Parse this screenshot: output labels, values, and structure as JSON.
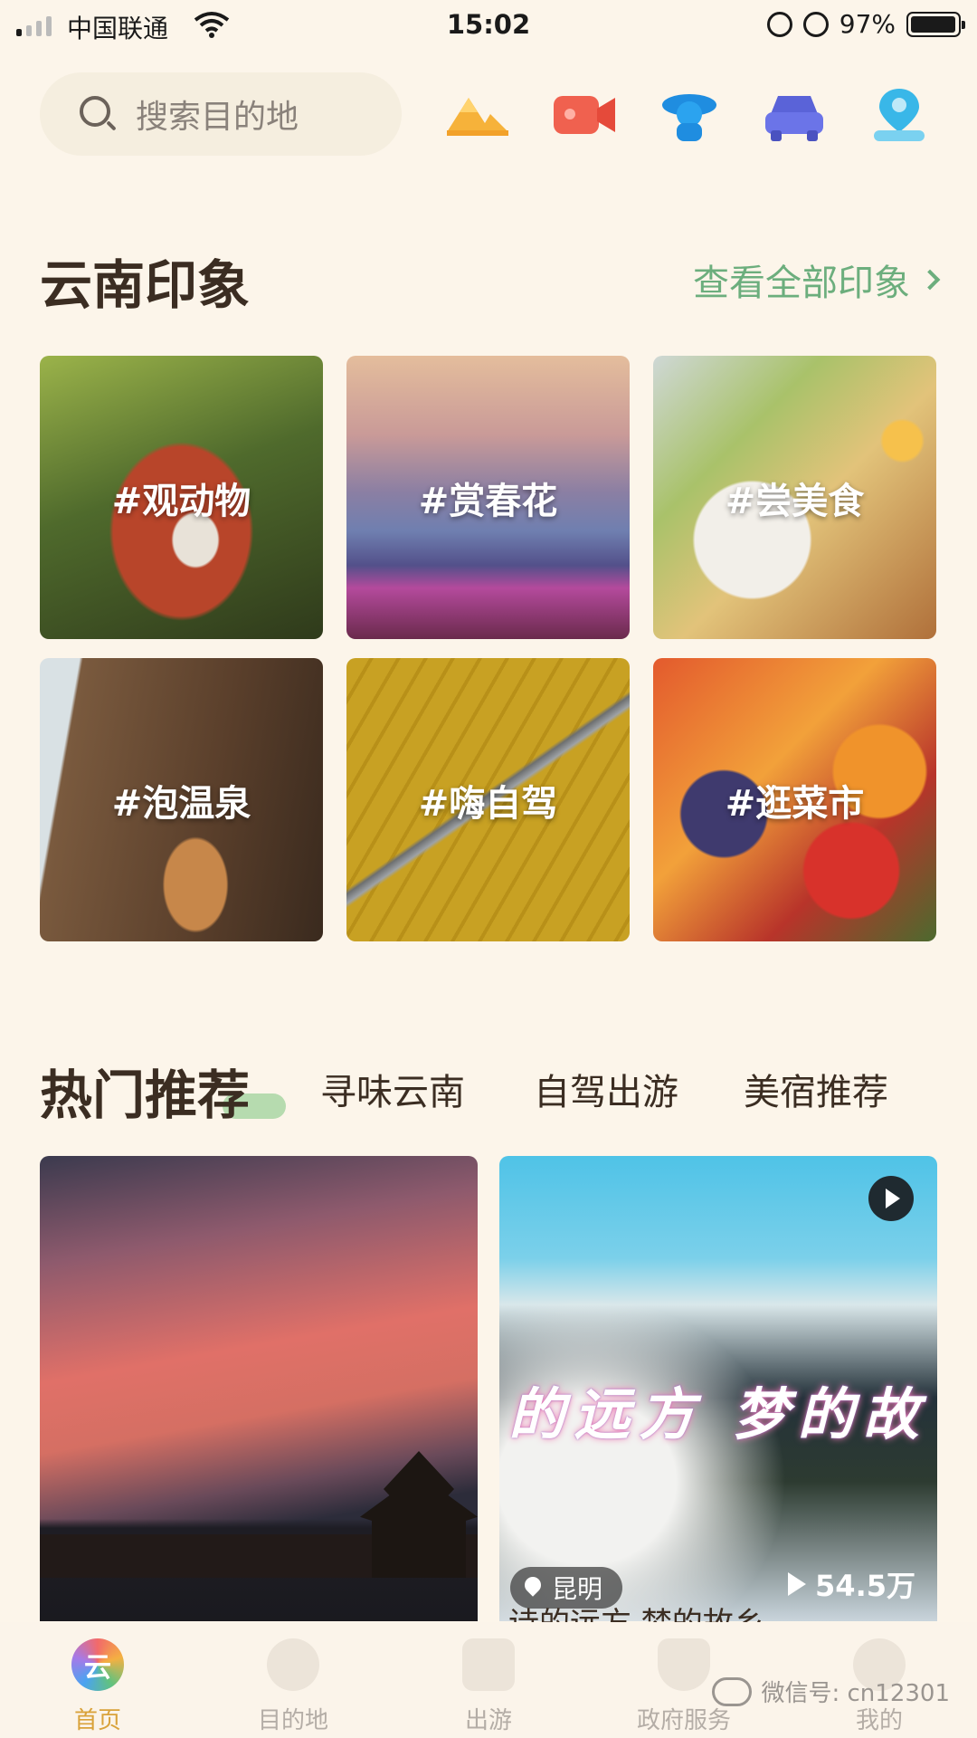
{
  "status_bar": {
    "carrier": "中国联通",
    "time": "15:02",
    "battery_percent": "97%",
    "battery_level": 0.97
  },
  "header": {
    "search_placeholder": "搜索目的地",
    "quick_icons": [
      "mountain-icon",
      "video-camera-icon",
      "guide-person-icon",
      "car-icon",
      "location-person-icon"
    ]
  },
  "impressions": {
    "title": "云南印象",
    "view_all": "查看全部印象",
    "tiles": [
      {
        "label": "#观动物"
      },
      {
        "label": "#赏春花"
      },
      {
        "label": "#尝美食"
      },
      {
        "label": "#泡温泉"
      },
      {
        "label": "#嗨自驾"
      },
      {
        "label": "#逛菜市"
      }
    ]
  },
  "hot": {
    "title": "热门推荐",
    "tabs": [
      "寻味云南",
      "自驾出游",
      "美宿推荐"
    ],
    "cards": [
      {},
      {
        "banner_text": "的远方  梦的故",
        "location": "昆明",
        "plays": "54.5万",
        "caption": "诗的远方 梦的故乡"
      }
    ]
  },
  "bottom_nav": {
    "items": [
      {
        "label": "首页",
        "icon": "yun-logo-icon",
        "active": true
      },
      {
        "label": "目的地",
        "icon": "map-pin-icon"
      },
      {
        "label": "出游",
        "icon": "suitcase-icon"
      },
      {
        "label": "政府服务",
        "icon": "shield-icon"
      },
      {
        "label": "我的",
        "icon": "person-icon"
      }
    ]
  },
  "watermark": "微信号: cn12301",
  "colors": {
    "background": "#fcf5ea",
    "accent_green": "#6cae7d",
    "active_nav": "#d9a23a"
  }
}
